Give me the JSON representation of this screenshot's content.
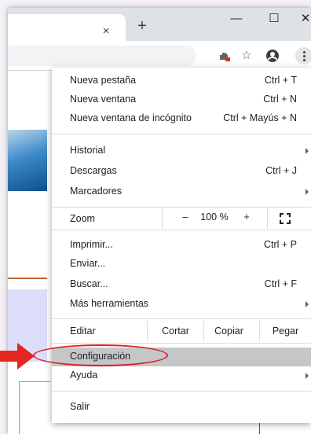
{
  "window": {
    "tab_close": "×",
    "new_tab": "+",
    "minimize": "—",
    "maximize": "☐",
    "close": "✕"
  },
  "toolbar": {
    "icons": [
      "extension-icon",
      "star-icon",
      "profile-icon",
      "more-vert-icon"
    ]
  },
  "menu": {
    "group1": [
      {
        "label": "Nueva pestaña",
        "shortcut": "Ctrl + T"
      },
      {
        "label": "Nueva ventana",
        "shortcut": "Ctrl + N"
      },
      {
        "label": "Nueva ventana de incógnito",
        "shortcut": "Ctrl + Mayús + N"
      }
    ],
    "group2": [
      {
        "label": "Historial",
        "shortcut": ""
      },
      {
        "label": "Descargas",
        "shortcut": "Ctrl + J"
      },
      {
        "label": "Marcadores",
        "shortcut": ""
      }
    ],
    "zoom": {
      "label": "Zoom",
      "minus": "–",
      "value": "100 %",
      "plus": "+"
    },
    "group3": [
      {
        "label": "Imprimir...",
        "shortcut": "Ctrl + P"
      },
      {
        "label": "Enviar...",
        "shortcut": ""
      },
      {
        "label": "Buscar...",
        "shortcut": "Ctrl + F"
      },
      {
        "label": "Más herramientas",
        "shortcut": ""
      }
    ],
    "edit": {
      "label": "Editar",
      "cut": "Cortar",
      "copy": "Copiar",
      "paste": "Pegar"
    },
    "group4": [
      {
        "label": "Configuración",
        "highlighted": true
      },
      {
        "label": "Ayuda"
      }
    ],
    "exit": {
      "label": "Salir"
    }
  },
  "colors": {
    "highlight": "#c5c6c8",
    "callout": "#d6232a"
  }
}
